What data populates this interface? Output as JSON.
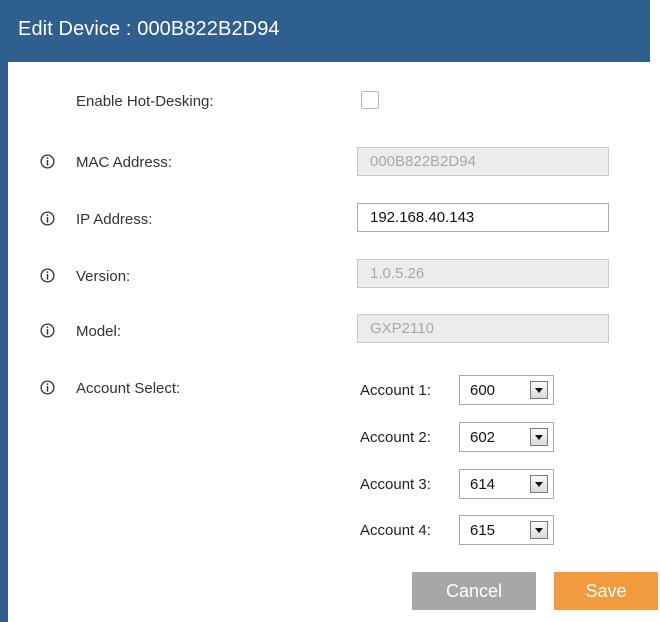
{
  "dialog": {
    "title": "Edit Device : 000B822B2D94"
  },
  "fields": {
    "hot_desking": {
      "label": "Enable Hot-Desking:",
      "checked": false
    },
    "mac": {
      "label": "MAC Address:",
      "value": "000B822B2D94"
    },
    "ip": {
      "label": "IP Address:",
      "value": "192.168.40.143"
    },
    "version": {
      "label": "Version:",
      "value": "1.0.5.26"
    },
    "model": {
      "label": "Model:",
      "value": "GXP2110"
    },
    "account_select": {
      "label": "Account Select:"
    }
  },
  "accounts": [
    {
      "label": "Account 1:",
      "value": "600"
    },
    {
      "label": "Account 2:",
      "value": "602"
    },
    {
      "label": "Account 3:",
      "value": "614"
    },
    {
      "label": "Account 4:",
      "value": "615"
    }
  ],
  "buttons": {
    "cancel": "Cancel",
    "save": "Save"
  },
  "icons": {
    "info": "info-icon",
    "dropdown": "chevron-down-icon"
  },
  "colors": {
    "titlebar": "#2f5f8f",
    "save_button": "#f29a3e",
    "cancel_button": "#a7a7a7"
  }
}
